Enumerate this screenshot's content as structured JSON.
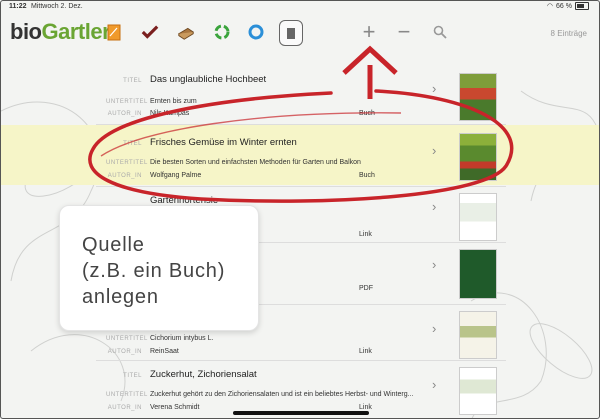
{
  "status": {
    "time": "11:22",
    "date": "Mittwoch 2. Dez.",
    "battery": "66 %"
  },
  "app": {
    "logo_bio": "bio",
    "logo_gartler": "Gartler",
    "entries": "8 Einträge"
  },
  "toolbar": {
    "icons": [
      "notes-icon",
      "check-icon",
      "book-icon",
      "recycle-icon",
      "circle-icon",
      "tablet-icon"
    ],
    "add": "+",
    "remove": "−",
    "search": "search-icon"
  },
  "labels": {
    "title": "TITEL",
    "subtitle": "UNTERTITEL",
    "author": "AUTOR_IN"
  },
  "rows": [
    {
      "title": "Das unglaubliche Hochbeet",
      "subtitle": "Ernten bis zum",
      "author": "Nils Kampas",
      "type": "Buch"
    },
    {
      "title": "Frisches Gemüse im Winter ernten",
      "subtitle": "Die besten Sorten und einfachsten Methoden für Garten und Balkon",
      "author": "Wolfgang Palme",
      "type": "Buch"
    },
    {
      "title": "Gartenhortensie",
      "subtitle": "",
      "author": "",
      "type": "Link"
    },
    {
      "title": "",
      "subtitle": "",
      "author": "",
      "type": "PDF"
    },
    {
      "title": "",
      "subtitle": "Cichorium intybus L.",
      "author": "ReinSaat",
      "type": "Link"
    },
    {
      "title": "Zuckerhut, Zichoriensalat",
      "subtitle": "Zuckerhut gehört zu den Zichoriensalaten und ist ein beliebtes Herbst- und Winterg...",
      "author": "Verena Schmidt",
      "type": "Link"
    }
  ],
  "callout": {
    "text": "Quelle\n(z.B. ein Buch)\nanlegen"
  },
  "colors": {
    "accent_green": "#6aa533",
    "arrow_red": "#c8242a",
    "highlight": "#f6f5c8"
  }
}
